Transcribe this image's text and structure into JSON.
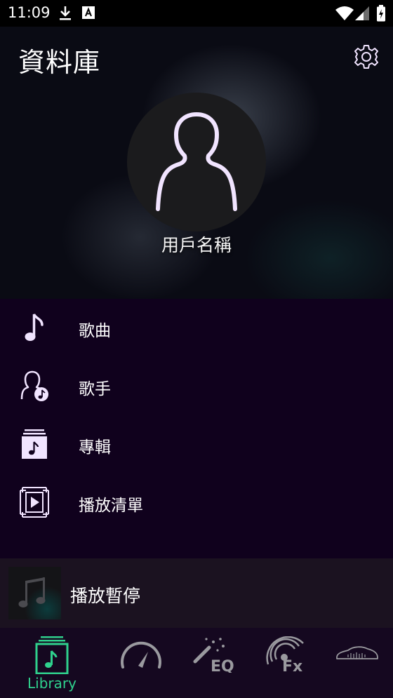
{
  "status_bar": {
    "time": "11:09",
    "icons": [
      "download-icon",
      "text-a-icon",
      "wifi-icon",
      "signal-icon",
      "battery-icon"
    ]
  },
  "header": {
    "title": "資料庫",
    "settings_icon": "gear-icon",
    "username": "用戶名稱"
  },
  "menu": {
    "items": [
      {
        "label": "歌曲",
        "icon": "music-note-icon"
      },
      {
        "label": "歌手",
        "icon": "artist-icon"
      },
      {
        "label": "專輯",
        "icon": "album-icon"
      },
      {
        "label": "播放清單",
        "icon": "playlist-icon"
      }
    ]
  },
  "now_playing": {
    "text": "播放暫停",
    "art_icon": "music-note-icon"
  },
  "bottom_nav": {
    "items": [
      {
        "label": "Library",
        "icon": "library-icon",
        "active": true
      },
      {
        "label": "",
        "icon": "speedometer-icon",
        "active": false
      },
      {
        "label": "",
        "icon": "eq-magic-icon",
        "active": false
      },
      {
        "label": "",
        "icon": "fx-signal-icon",
        "active": false
      },
      {
        "label": "",
        "icon": "car-icon",
        "active": false
      }
    ]
  },
  "colors": {
    "background": "#10011d",
    "accent": "#2fd18d",
    "icon_stroke": "#f1e4ff",
    "nav_icon_gray": "#9a9a9f"
  }
}
